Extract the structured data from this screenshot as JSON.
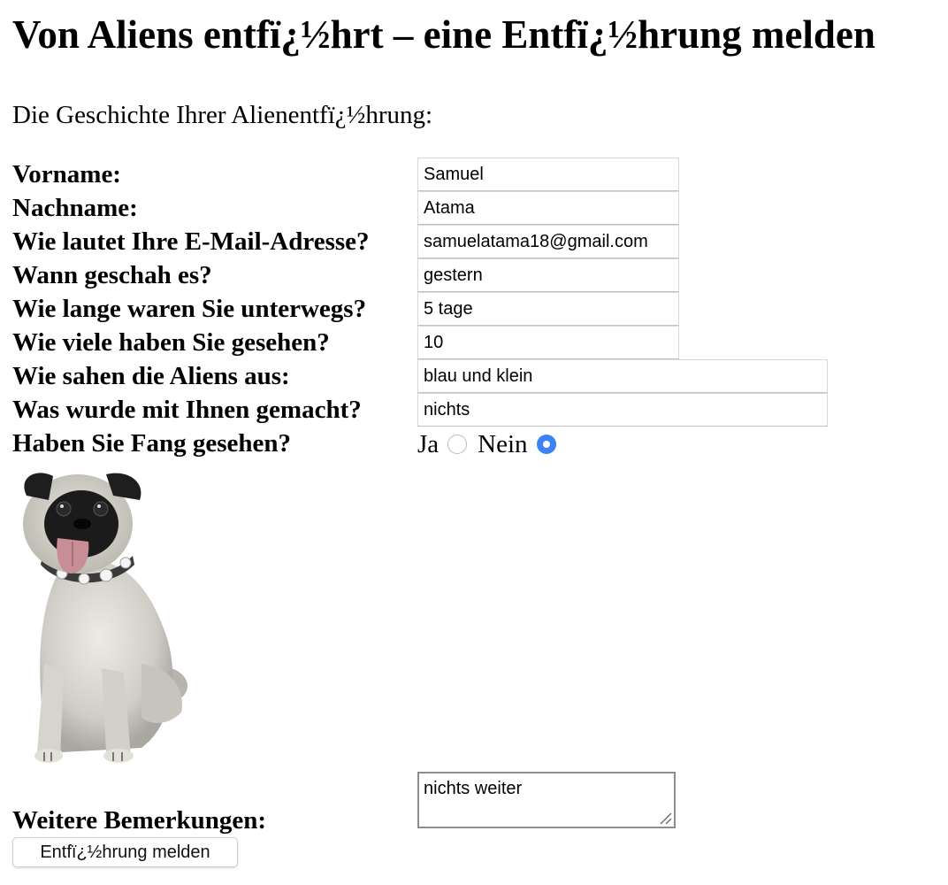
{
  "page": {
    "title": "Von Aliens entfï¿½hrt – eine Entfï¿½hrung melden",
    "intro": "Die Geschichte Ihrer Alienentfï¿½hrung:"
  },
  "form": {
    "first_name": {
      "label": "Vorname:",
      "value": "Samuel"
    },
    "last_name": {
      "label": "Nachname:",
      "value": "Atama"
    },
    "email": {
      "label": "Wie lautet Ihre E-Mail-Adresse?",
      "value": "samuelatama18@gmail.com"
    },
    "when": {
      "label": "Wann geschah es?",
      "value": "gestern"
    },
    "duration": {
      "label": "Wie lange waren Sie unterwegs?",
      "value": "5 tage"
    },
    "how_many": {
      "label": "Wie viele haben Sie gesehen?",
      "value": "10"
    },
    "description": {
      "label": "Wie sahen die Aliens aus:",
      "value": "blau und klein"
    },
    "what_happened": {
      "label": "Was wurde mit Ihnen gemacht?",
      "value": "nichts"
    },
    "fang_spotted": {
      "label": "Haben Sie Fang gesehen?",
      "options": [
        "Ja",
        "Nein"
      ],
      "selected": "Nein"
    },
    "comments": {
      "label": "Weitere Bemerkungen:",
      "value": "nichts weiter"
    },
    "submit_label": "Entfï¿½hrung melden"
  },
  "colors": {
    "radio_checked": "#3b82f6"
  }
}
